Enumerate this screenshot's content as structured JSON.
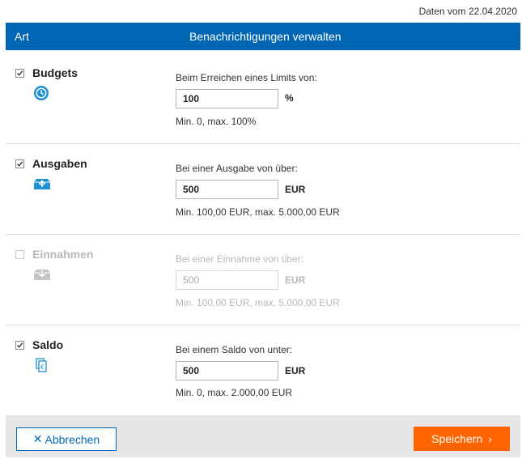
{
  "date_line": "Daten vom 22.04.2020",
  "header": {
    "col_type": "Art",
    "col_manage": "Benachrichtigungen verwalten"
  },
  "rows": [
    {
      "label": "Budgets",
      "checked": true,
      "icon": "clock-icon",
      "rule": "Beim Erreichen eines Limits von:",
      "value": "100",
      "unit": "%",
      "hint": "Min. 0, max. 100%"
    },
    {
      "label": "Ausgaben",
      "checked": true,
      "icon": "outbox-icon",
      "rule": "Bei einer Ausgabe von über:",
      "value": "500",
      "unit": "EUR",
      "hint": "Min. 100,00 EUR, max. 5.000,00 EUR"
    },
    {
      "label": "Einnahmen",
      "checked": false,
      "icon": "inbox-icon",
      "rule": "Bei einer Einnahme von über:",
      "value": "500",
      "unit": "EUR",
      "hint": "Min. 100,00 EUR, max. 5.000,00 EUR"
    },
    {
      "label": "Saldo",
      "checked": true,
      "icon": "euro-document-icon",
      "rule": "Bei einem Saldo von unter:",
      "value": "500",
      "unit": "EUR",
      "hint": "Min. 0, max. 2.000,00 EUR"
    }
  ],
  "footer": {
    "cancel_label": "Abbrechen",
    "save_label": "Speichern"
  },
  "colors": {
    "header": "#0066b3",
    "save": "#ff6400",
    "icon": "#1e8fd2",
    "disabled": "#b8b8b8"
  }
}
